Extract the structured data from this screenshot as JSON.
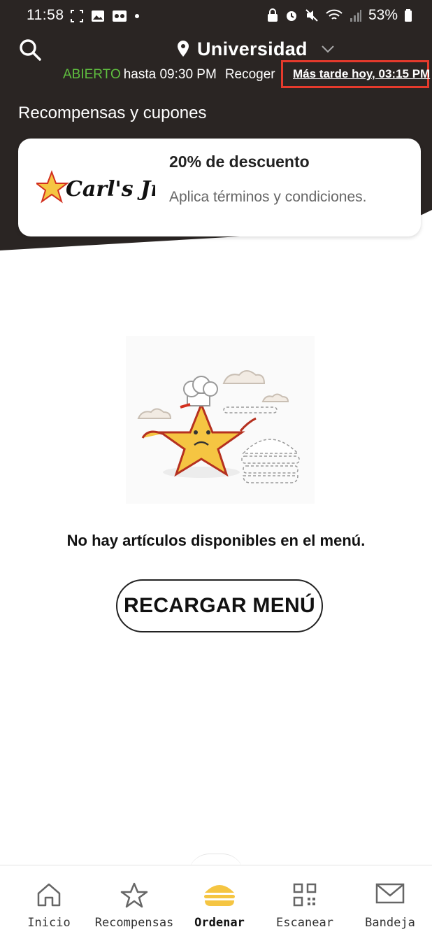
{
  "colors": {
    "header_bg": "#2a2523",
    "open_green": "#5fbf3f",
    "highlight_red": "#e53a2c",
    "accent_yellow": "#f5c542"
  },
  "status_bar": {
    "time": "11:58",
    "battery": "53%"
  },
  "header": {
    "location": "Universidad",
    "open_status": "ABIERTO",
    "hours": "hasta 09:30 PM",
    "pickup_label": "Recoger",
    "pickup_time": "Más tarde hoy, 03:15 PM"
  },
  "rewards": {
    "section_title": "Recompensas y cupones",
    "coupon": {
      "brand": "Carl's Jr.",
      "title": "20% de descuento",
      "subtitle": "Aplica términos y condiciones."
    }
  },
  "empty_state": {
    "message": "No hay artículos disponibles en el menú.",
    "button_label": "RECARGAR MENÚ"
  },
  "nav": {
    "items": [
      {
        "label": "Inicio",
        "icon": "home-icon"
      },
      {
        "label": "Recompensas",
        "icon": "star-icon"
      },
      {
        "label": "Ordenar",
        "icon": "burger-icon",
        "active": true
      },
      {
        "label": "Escanear",
        "icon": "qr-icon"
      },
      {
        "label": "Bandeja",
        "icon": "mail-icon"
      }
    ]
  }
}
